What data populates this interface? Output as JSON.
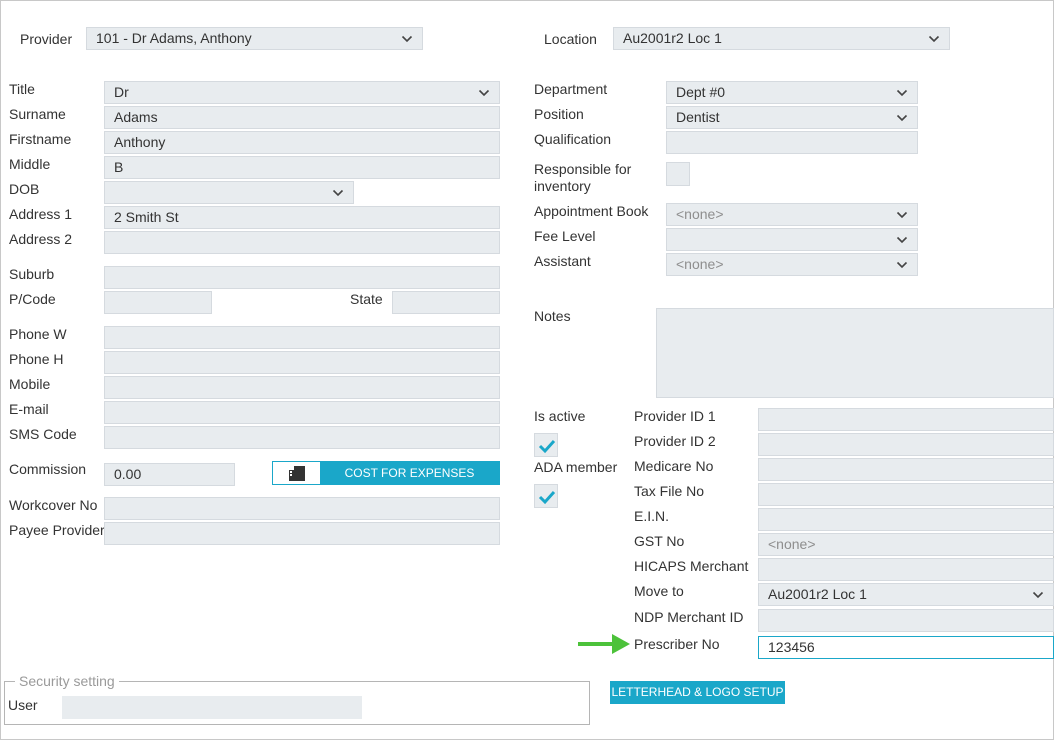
{
  "provider": {
    "label": "Provider",
    "value": "101 - Dr Adams, Anthony"
  },
  "location": {
    "label": "Location",
    "value": "Au2001r2 Loc 1"
  },
  "left": {
    "title": {
      "label": "Title",
      "value": "Dr"
    },
    "surname": {
      "label": "Surname",
      "value": "Adams"
    },
    "firstname": {
      "label": "Firstname",
      "value": "Anthony"
    },
    "middle": {
      "label": "Middle",
      "value": "B"
    },
    "dob": {
      "label": "DOB",
      "value": ""
    },
    "address1": {
      "label": "Address 1",
      "value": "2 Smith St"
    },
    "address2": {
      "label": "Address 2",
      "value": ""
    },
    "suburb": {
      "label": "Suburb",
      "value": ""
    },
    "pcode": {
      "label": "P/Code",
      "value": ""
    },
    "state": {
      "label": "State",
      "value": ""
    },
    "phone_w": {
      "label": "Phone W",
      "value": ""
    },
    "phone_h": {
      "label": "Phone H",
      "value": ""
    },
    "mobile": {
      "label": "Mobile",
      "value": ""
    },
    "email": {
      "label": "E-mail",
      "value": ""
    },
    "sms_code": {
      "label": "SMS Code",
      "value": ""
    },
    "commission": {
      "label": "Commission",
      "value": "0.00"
    },
    "cost_button": "COST FOR EXPENSES",
    "workcover": {
      "label": "Workcover No",
      "value": ""
    },
    "payee": {
      "label": "Payee Provider",
      "value": ""
    }
  },
  "right": {
    "department": {
      "label": "Department",
      "value": "Dept #0"
    },
    "position": {
      "label": "Position",
      "value": "Dentist"
    },
    "qualification": {
      "label": "Qualification",
      "value": ""
    },
    "responsible": {
      "label_line1": "Responsible for",
      "label_line2": "inventory",
      "checked": false
    },
    "appointment_book": {
      "label": "Appointment Book",
      "value": "<none>"
    },
    "fee_level": {
      "label": "Fee Level",
      "value": ""
    },
    "assistant": {
      "label": "Assistant",
      "value": "<none>"
    },
    "notes": {
      "label": "Notes",
      "value": ""
    },
    "is_active": {
      "label": "Is active",
      "checked": true
    },
    "ada_member": {
      "label": "ADA member",
      "checked": true
    },
    "provider_id1": {
      "label": "Provider ID 1",
      "value": ""
    },
    "provider_id2": {
      "label": "Provider ID 2",
      "value": ""
    },
    "medicare": {
      "label": "Medicare No",
      "value": ""
    },
    "tax_file": {
      "label": "Tax File No",
      "value": ""
    },
    "ein": {
      "label": "E.I.N.",
      "value": ""
    },
    "gst": {
      "label": "GST No",
      "value": "<none>"
    },
    "hicaps": {
      "label": "HICAPS Merchant",
      "value": ""
    },
    "move_to": {
      "label": "Move to",
      "value": "Au2001r2 Loc 1"
    },
    "ndp": {
      "label": "NDP Merchant ID",
      "value": ""
    },
    "prescriber": {
      "label": "Prescriber No",
      "value": "123456"
    }
  },
  "security": {
    "title": "Security setting",
    "user_label": "User",
    "user_value": ""
  },
  "letterhead_button": "LETTERHEAD & LOGO SETUP",
  "colors": {
    "accent": "#1aa7c9",
    "field_bg": "#e8ecef",
    "arrow": "#4cc23a"
  },
  "icons": {
    "chevron": "chevron-down-icon",
    "check": "checkmark-icon",
    "cost": "expenses-icon",
    "arrow": "arrow-right-icon"
  }
}
